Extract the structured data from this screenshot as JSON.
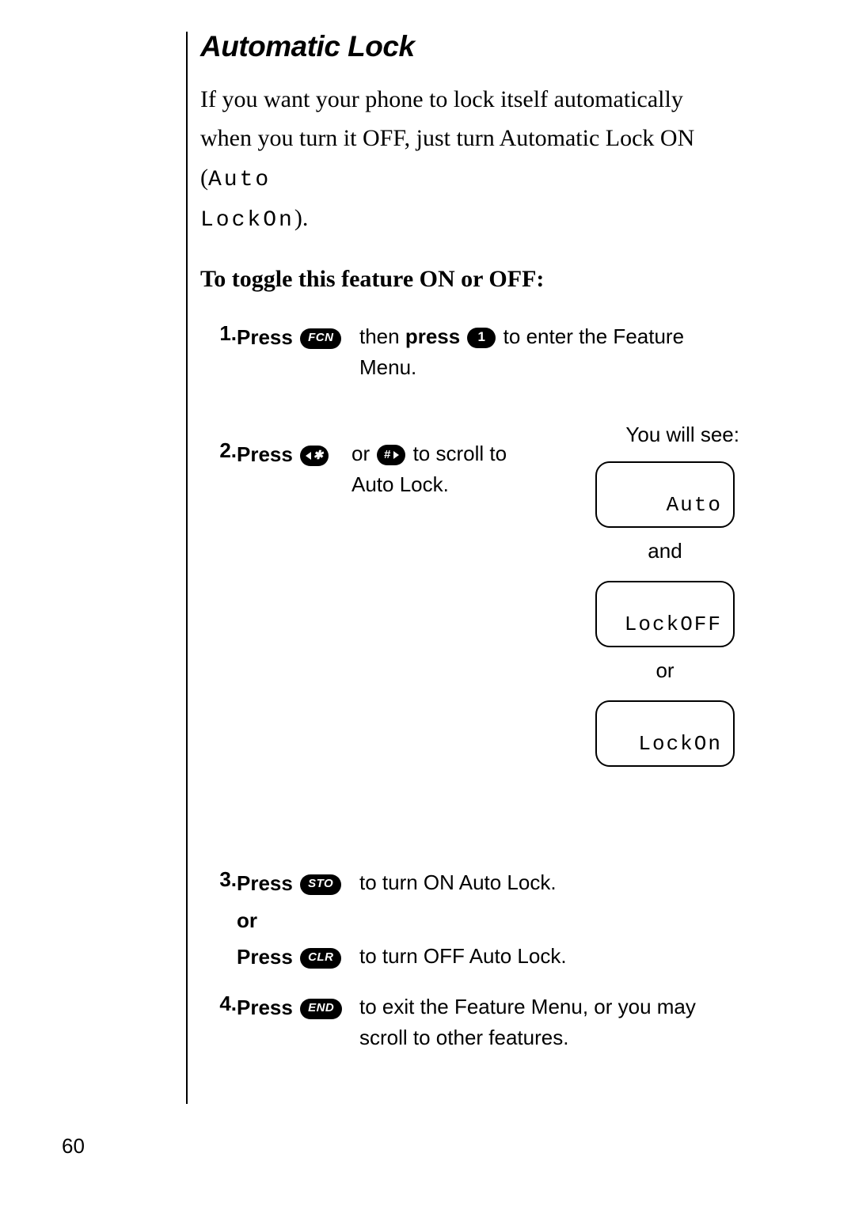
{
  "title": "Automatic Lock",
  "intro_1": "If you want your phone to lock itself automatically when you turn it OFF, just turn Automatic Lock ON (",
  "intro_seg1": "Auto",
  "intro_seg2": "LockOn",
  "intro_close": ").",
  "subheading": "To toggle this feature ON or OFF:",
  "steps": {
    "s1": {
      "num": "1.",
      "press": "Press",
      "btn1": "FCN",
      "mid1": " then ",
      "press2": "press",
      "btn2": "1",
      "after": " to enter the Feature Menu."
    },
    "s2": {
      "num": "2.",
      "press": "Press",
      "btn_star": "✱",
      "or": " or ",
      "btn_hash": "#",
      "after": " to scroll to Auto Lock."
    },
    "s3a": {
      "num": "3.",
      "press": "Press",
      "btn": "STO",
      "after": " to turn ON Auto Lock."
    },
    "s3_or": "or",
    "s3b": {
      "press": "Press",
      "btn": "CLR",
      "after": " to turn OFF Auto Lock."
    },
    "s4": {
      "num": "4.",
      "press": "Press",
      "btn": "END",
      "after": " to exit the Feature Menu, or you may scroll to other features."
    }
  },
  "side": {
    "you_will_see": "You will see:",
    "box1": "Auto",
    "and": "and",
    "box2": "LockOFF",
    "or": "or",
    "box3": "LockOn"
  },
  "page_number": "60"
}
